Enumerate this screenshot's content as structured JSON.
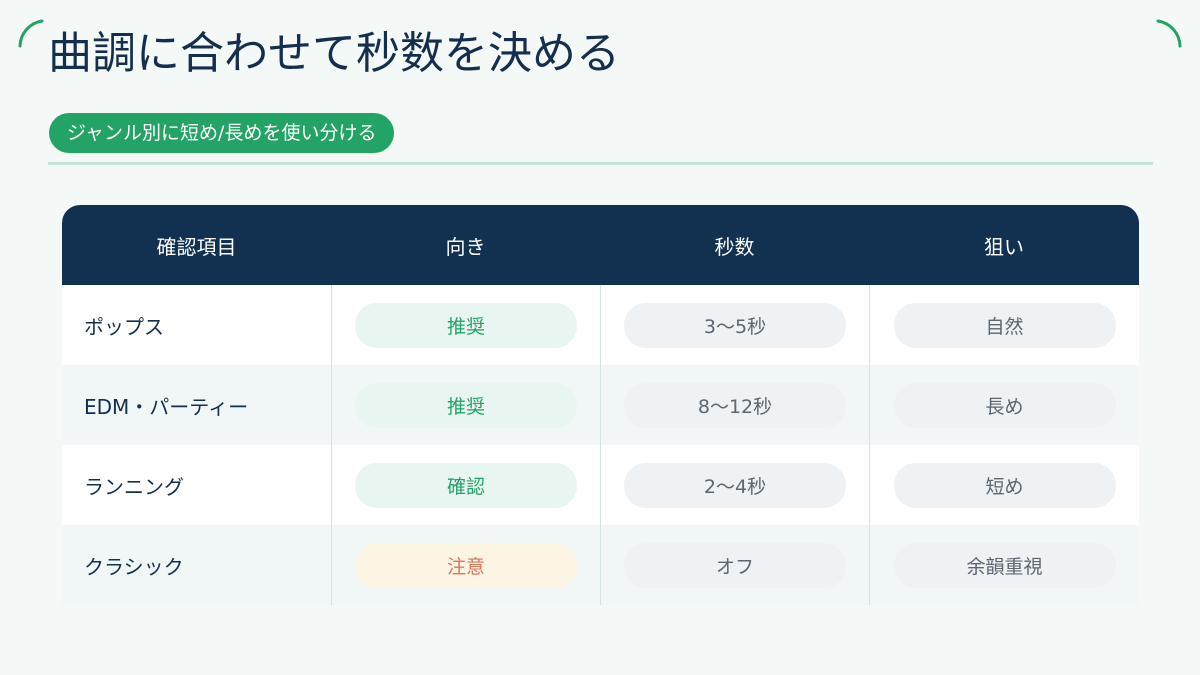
{
  "title": "曲調に合わせて秒数を決める",
  "subtitle": "ジャンル別に短め/長めを使い分ける",
  "colors": {
    "background": "#f4f9f8",
    "accent": "#23a366",
    "header_bg": "#12304f",
    "warning_text": "#d9775a"
  },
  "table": {
    "headers": [
      "確認項目",
      "向き",
      "秒数",
      "狙い"
    ],
    "rows": [
      {
        "item": "ポップス",
        "suitability": "推奨",
        "suitability_status": "ok",
        "seconds": "3〜5秒",
        "aim": "自然"
      },
      {
        "item": "EDM・パーティー",
        "suitability": "推奨",
        "suitability_status": "ok",
        "seconds": "8〜12秒",
        "aim": "長め"
      },
      {
        "item": "ランニング",
        "suitability": "確認",
        "suitability_status": "ok",
        "seconds": "2〜4秒",
        "aim": "短め"
      },
      {
        "item": "クラシック",
        "suitability": "注意",
        "suitability_status": "warn",
        "seconds": "オフ",
        "aim": "余韻重視"
      }
    ]
  }
}
